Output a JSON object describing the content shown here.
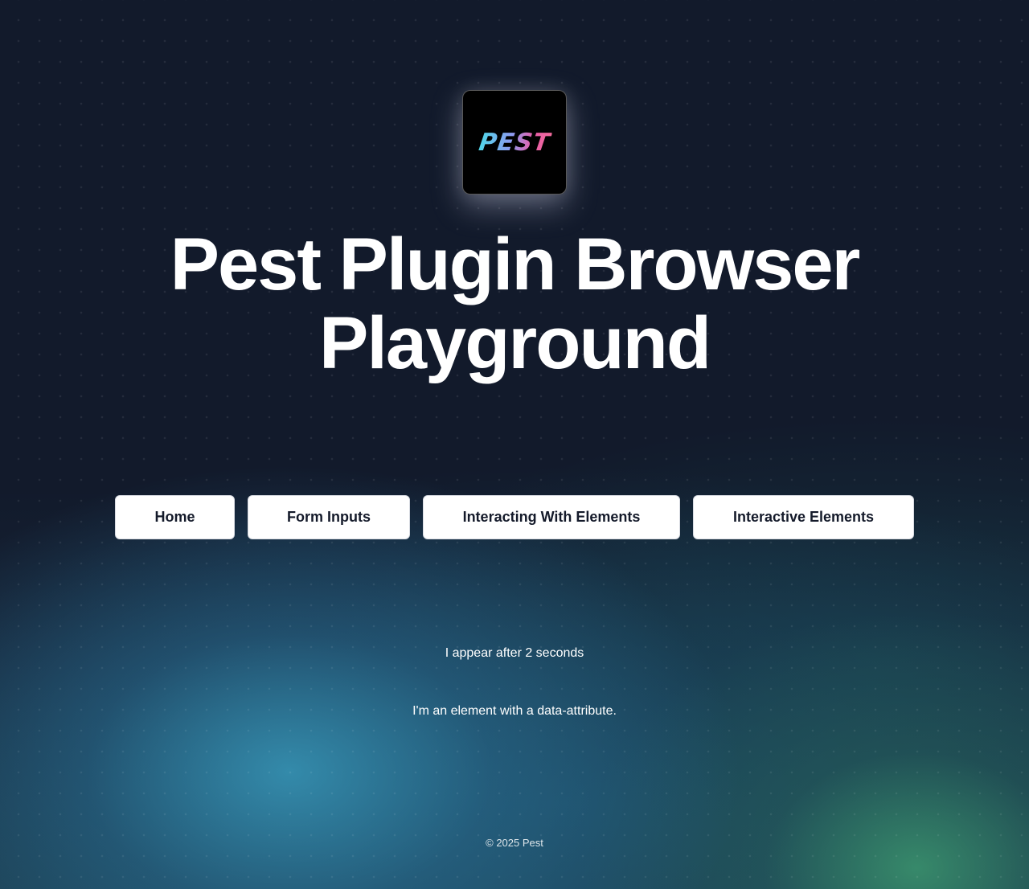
{
  "header": {
    "logo_text": "PEST",
    "title_line1": "Pest Plugin Browser",
    "title_line2": "Playground"
  },
  "nav": {
    "items": [
      {
        "label": "Home"
      },
      {
        "label": "Form Inputs"
      },
      {
        "label": "Interacting With Elements"
      },
      {
        "label": "Interactive Elements"
      }
    ]
  },
  "main": {
    "delayed_message": "I appear after 2 seconds",
    "data_attribute_message": "I'm an element with a data-attribute."
  },
  "footer": {
    "copyright": "© 2025 Pest"
  },
  "colors": {
    "background": "#121a2b",
    "button_bg": "#ffffff",
    "button_text": "#141a2a",
    "logo_gradient_start": "#4fd6e8",
    "logo_gradient_end": "#f06a9a"
  }
}
